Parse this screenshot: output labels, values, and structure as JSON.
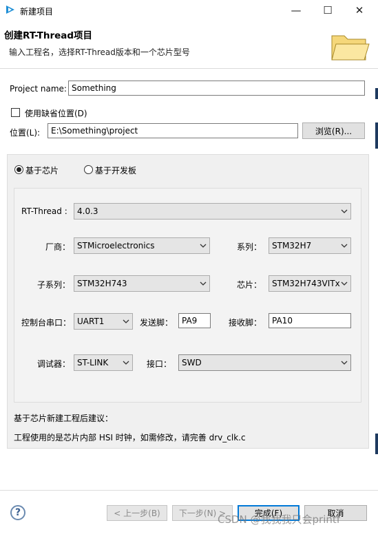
{
  "window": {
    "title": "新建项目",
    "minimize_glyph": "—",
    "maximize_glyph": "☐",
    "close_glyph": "✕"
  },
  "header": {
    "title": "创建RT-Thread项目",
    "description": "输入工程名，选择RT-Thread版本和一个芯片型号",
    "icon": "folder-open-icon"
  },
  "project": {
    "name_label": "Project name:",
    "name_value": "Something",
    "use_default_location_label": "使用缺省位置(D)",
    "use_default_location_checked": false,
    "location_label": "位置(L):",
    "location_value": "E:\\Something\\project",
    "browse_label": "浏览(R)..."
  },
  "mode": {
    "chip_label": "基于芯片",
    "board_label": "基于开发板",
    "selected": "chip"
  },
  "config": {
    "rtthread_label": "RT-Thread :",
    "rtthread_value": "4.0.3",
    "vendor_label": "厂商：",
    "vendor_value": "STMicroelectronics",
    "series_label": "系列：",
    "series_value": "STM32H7",
    "subseries_label": "子系列：",
    "subseries_value": "STM32H743",
    "chip_label": "芯片：",
    "chip_value": "STM32H743VITx",
    "console_label": "控制台串口：",
    "console_value": "UART1",
    "tx_label": "发送脚：",
    "tx_value": "PA9",
    "rx_label": "接收脚：",
    "rx_value": "PA10",
    "debugger_label": "调试器：",
    "debugger_value": "ST-LINK",
    "interface_label": "接口：",
    "interface_value": "SWD"
  },
  "advice": {
    "title": "基于芯片新建工程后建议：",
    "text": "工程使用的是芯片内部 HSI 时钟，如需修改，请完善 drv_clk.c"
  },
  "footer": {
    "help_glyph": "?",
    "back_label": "< 上一步(B)",
    "next_label": "下一步(N) >",
    "finish_label": "完成(F)",
    "cancel_label": "取消"
  },
  "watermark": "CSDN @我我我只会printf"
}
